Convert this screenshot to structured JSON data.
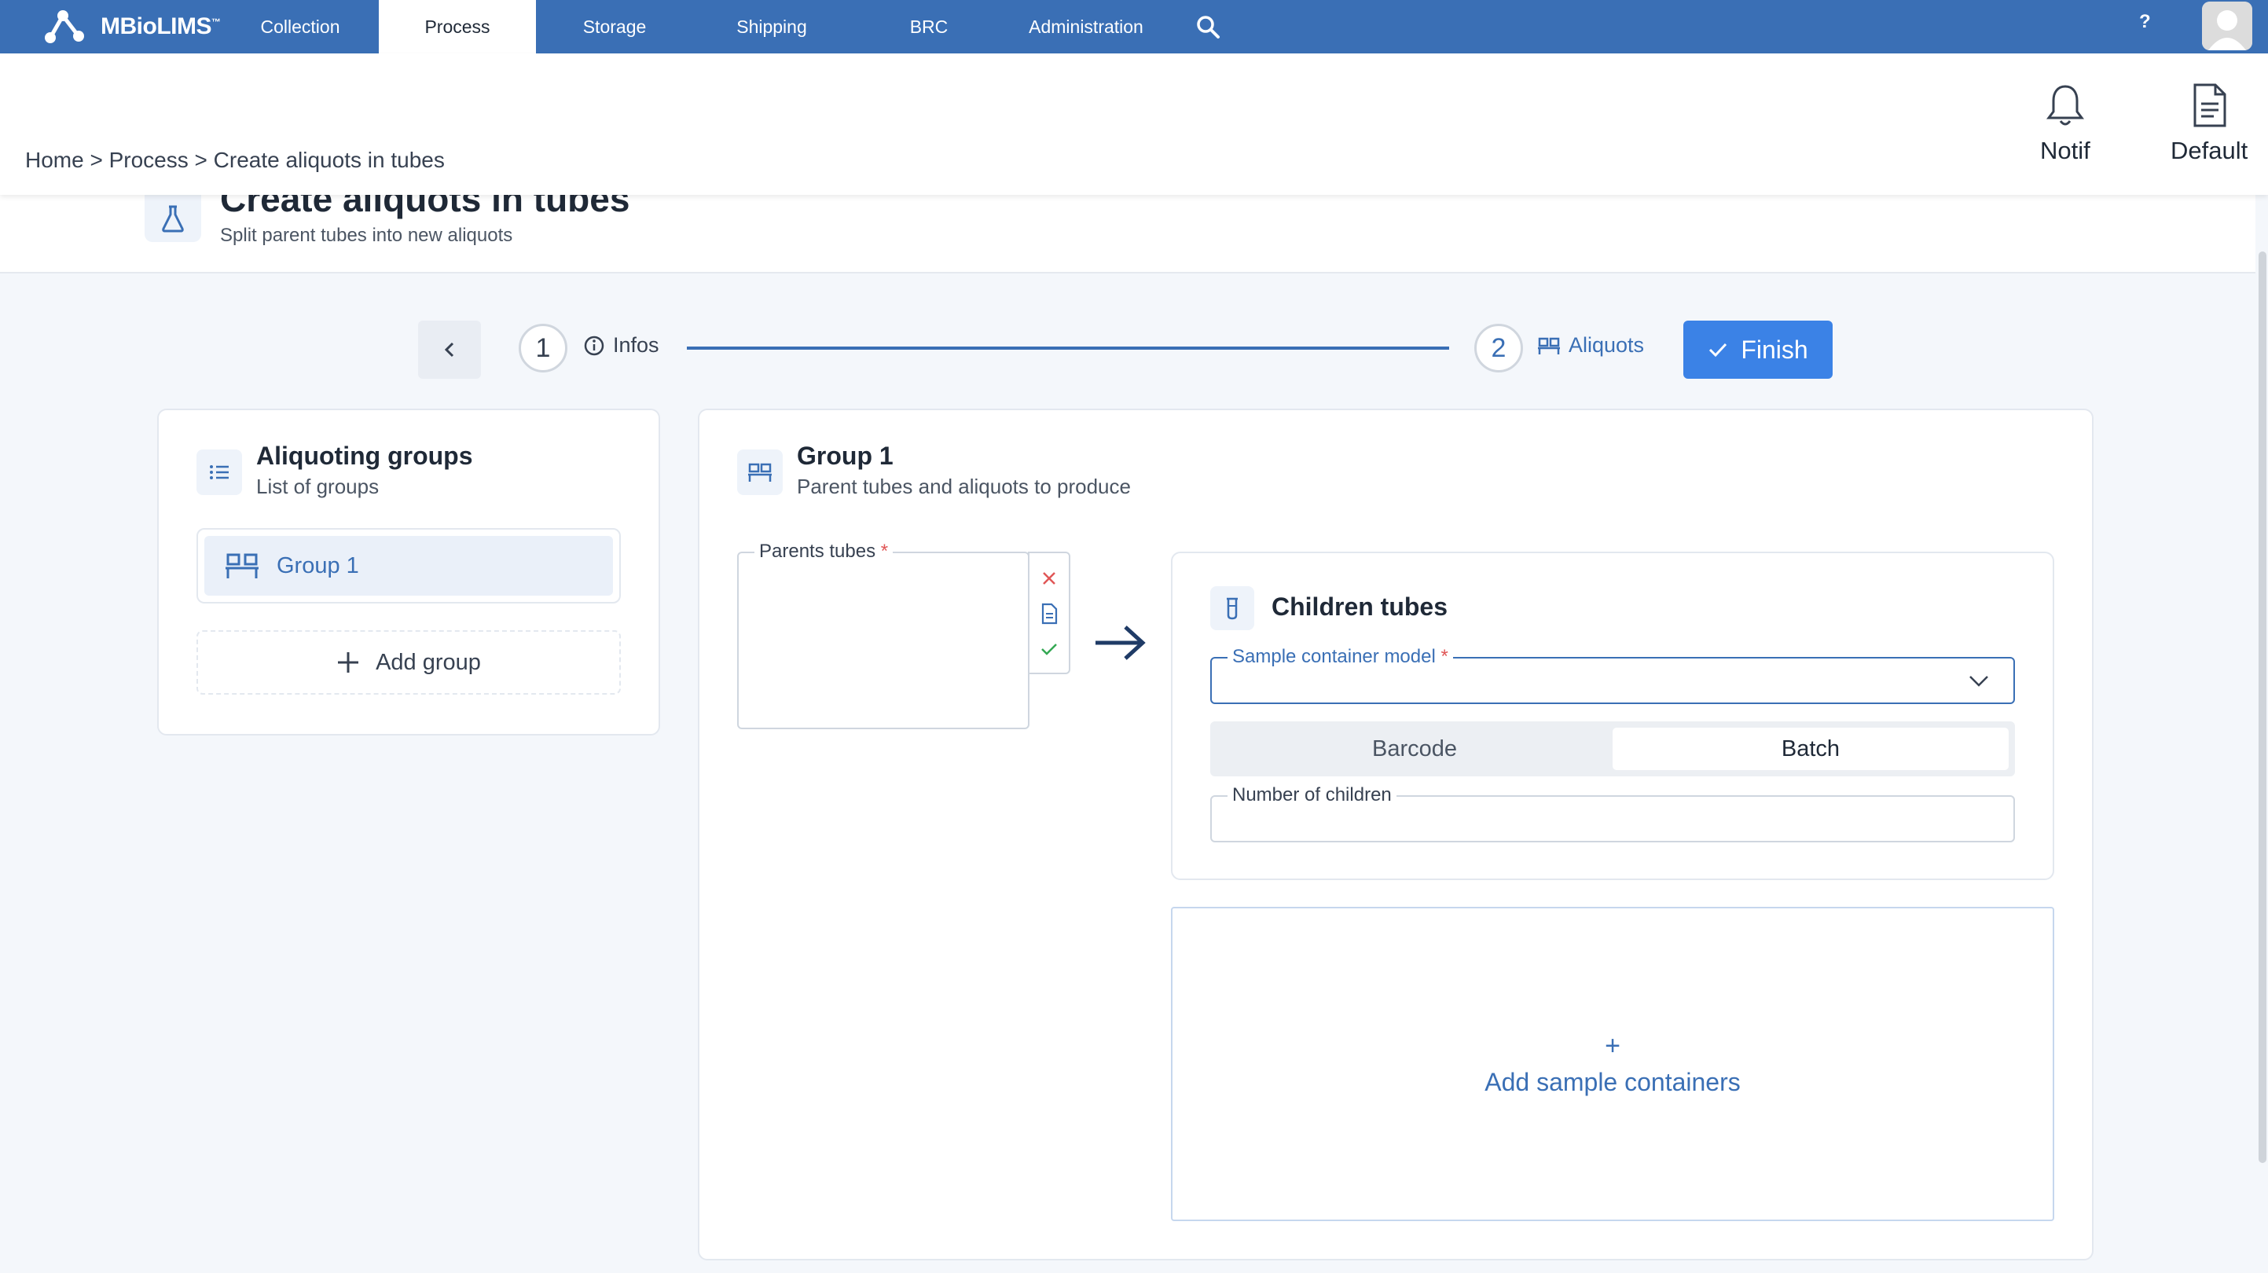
{
  "brand": {
    "name": "MBioLIMS",
    "mark": "™"
  },
  "nav": {
    "items": [
      {
        "label": "Collection"
      },
      {
        "label": "Process"
      },
      {
        "label": "Storage"
      },
      {
        "label": "Shipping"
      },
      {
        "label": "BRC"
      },
      {
        "label": "Administration"
      }
    ],
    "active": "Process",
    "help_label": "?"
  },
  "header": {
    "breadcrumb": "Home > Process > Create aliquots in tubes",
    "notif_label": "Notif",
    "default_label": "Default"
  },
  "page": {
    "title": "Create aliquots in tubes",
    "subtitle": "Split parent tubes into new aliquots"
  },
  "stepper": {
    "steps": [
      {
        "number": "1",
        "label": "Infos"
      },
      {
        "number": "2",
        "label": "Aliquots"
      }
    ],
    "finish_label": "Finish"
  },
  "groups_panel": {
    "title": "Aliquoting groups",
    "subtitle": "List of groups",
    "items": [
      {
        "label": "Group 1"
      }
    ],
    "add_label": "Add group"
  },
  "group_detail": {
    "title": "Group 1",
    "subtitle": "Parent tubes and aliquots to produce",
    "parents_label": "Parents tubes",
    "required_mark": "*"
  },
  "children": {
    "title": "Children tubes",
    "container_model_label": "Sample container model",
    "toggle": [
      {
        "label": "Barcode"
      },
      {
        "label": "Batch"
      }
    ],
    "toggle_selected": "Batch",
    "number_label": "Number of children",
    "number_value": ""
  },
  "add_containers": {
    "plus": "+",
    "label": "Add sample containers"
  },
  "colors": {
    "nav_bg": "#3a6fb5",
    "accent": "#3b82e6",
    "page_bg": "#f4f7fb",
    "danger": "#e05656",
    "success": "#34a853"
  },
  "icons": [
    "logo-molecule-icon",
    "search-icon",
    "bell-icon",
    "document-icon",
    "flask-icon",
    "chevron-left-icon",
    "info-icon",
    "rack-icon",
    "check-icon",
    "list-icon",
    "plus-icon",
    "close-icon",
    "file-icon",
    "arrow-right-icon",
    "tube-icon",
    "chevron-down-icon"
  ]
}
